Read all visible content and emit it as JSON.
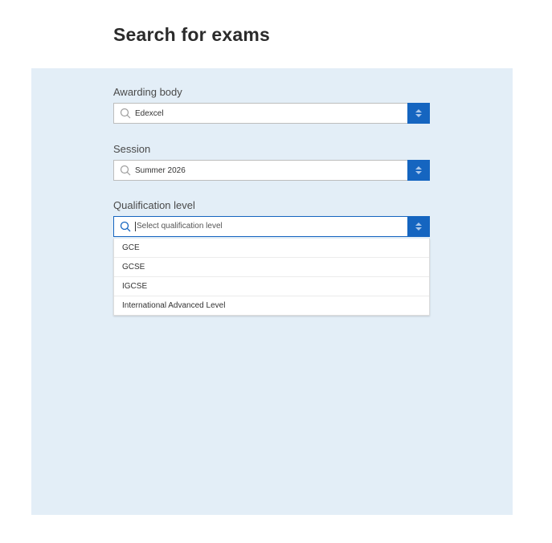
{
  "page": {
    "title": "Search for exams"
  },
  "colors": {
    "panel_background": "#e3eef7",
    "accent": "#1565c0"
  },
  "awarding_body": {
    "label": "Awarding body",
    "value": "Edexcel",
    "icon": "search-icon",
    "toggle_icon": "sort-arrows-icon"
  },
  "session": {
    "label": "Session",
    "value": "Summer 2026",
    "icon": "search-icon",
    "toggle_icon": "sort-arrows-icon"
  },
  "qualification_level": {
    "label": "Qualification level",
    "value": "",
    "placeholder": "Select qualification level",
    "icon": "search-icon",
    "toggle_icon": "sort-arrows-icon",
    "options": [
      "GCE",
      "GCSE",
      "IGCSE",
      "International Advanced Level"
    ]
  }
}
